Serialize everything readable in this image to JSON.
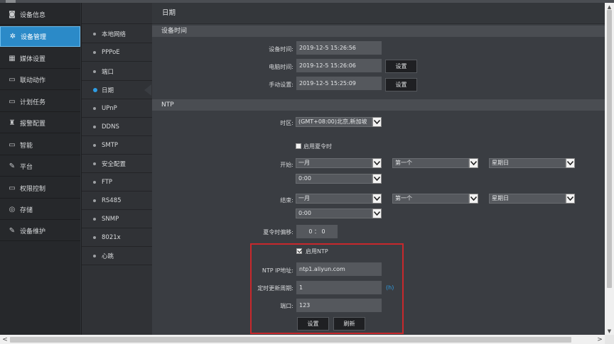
{
  "sidebar": {
    "items": [
      {
        "label": "设备信息",
        "icon": "camera-icon",
        "glyph": "◙"
      },
      {
        "label": "设备管理",
        "icon": "gear-icon",
        "glyph": "✲"
      },
      {
        "label": "媒体设置",
        "icon": "media-icon",
        "glyph": "▦"
      },
      {
        "label": "联动动作",
        "icon": "link-action-icon",
        "glyph": "▭"
      },
      {
        "label": "计划任务",
        "icon": "schedule-icon",
        "glyph": "▭"
      },
      {
        "label": "报警配置",
        "icon": "alarm-icon",
        "glyph": "♜"
      },
      {
        "label": "智能",
        "icon": "monitor-icon",
        "glyph": "▭"
      },
      {
        "label": "平台",
        "icon": "platform-icon",
        "glyph": "✎"
      },
      {
        "label": "权限控制",
        "icon": "permission-icon",
        "glyph": "▭"
      },
      {
        "label": "存储",
        "icon": "storage-icon",
        "glyph": "◎"
      },
      {
        "label": "设备维护",
        "icon": "wrench-icon",
        "glyph": "✎"
      }
    ],
    "active_index": 1
  },
  "submenu": {
    "items": [
      "本地网络",
      "PPPoE",
      "端口",
      "日期",
      "UPnP",
      "DDNS",
      "SMTP",
      "安全配置",
      "FTP",
      "RS485",
      "SNMP",
      "8021x",
      "心跳"
    ],
    "active_index": 3
  },
  "page": {
    "title": "日期",
    "device_time_section": "设备时间",
    "ntp_section": "NTP"
  },
  "device_time": {
    "device_label": "设备时间:",
    "device_value": "2019-12-5 15:26:56",
    "pc_label": "电脑时间:",
    "pc_value": "2019-12-5 15:26:06",
    "pc_set": "设置",
    "manual_label": "手动设置:",
    "manual_value": "2019-12-5 15:25:09",
    "manual_set": "设置"
  },
  "ntp": {
    "tz_label": "时区:",
    "tz_value": "(GMT+08:00)北京,新加坡",
    "dst_enable_label": "启用夏令时",
    "start_label": "开始:",
    "start_month": "一月",
    "start_week": "第一个",
    "start_day": "星期日",
    "start_time": "0:00",
    "end_label": "结束:",
    "end_month": "一月",
    "end_week": "第一个",
    "end_day": "星期日",
    "end_time": "0:00",
    "offset_label": "夏令时偏移:",
    "offset_value": "0 ： 0",
    "enable_ntp_label": "启用NTP",
    "enable_ntp_checked": true,
    "ip_label": "NTP IP地址:",
    "ip_value": "ntp1.aliyun.com",
    "period_label": "定时更新周期:",
    "period_value": "1",
    "period_unit": "(h)",
    "port_label": "端口:",
    "port_value": "123",
    "set_button": "设置",
    "refresh_button": "刷新"
  },
  "scroll": {
    "left_arrow": "<",
    "right_arrow": ">",
    "up_arrow": "▲",
    "down_arrow": "▼"
  },
  "colors": {
    "accent": "#2b8ac8",
    "highlight_box": "#c8282c",
    "unit": "#2e9de4"
  }
}
